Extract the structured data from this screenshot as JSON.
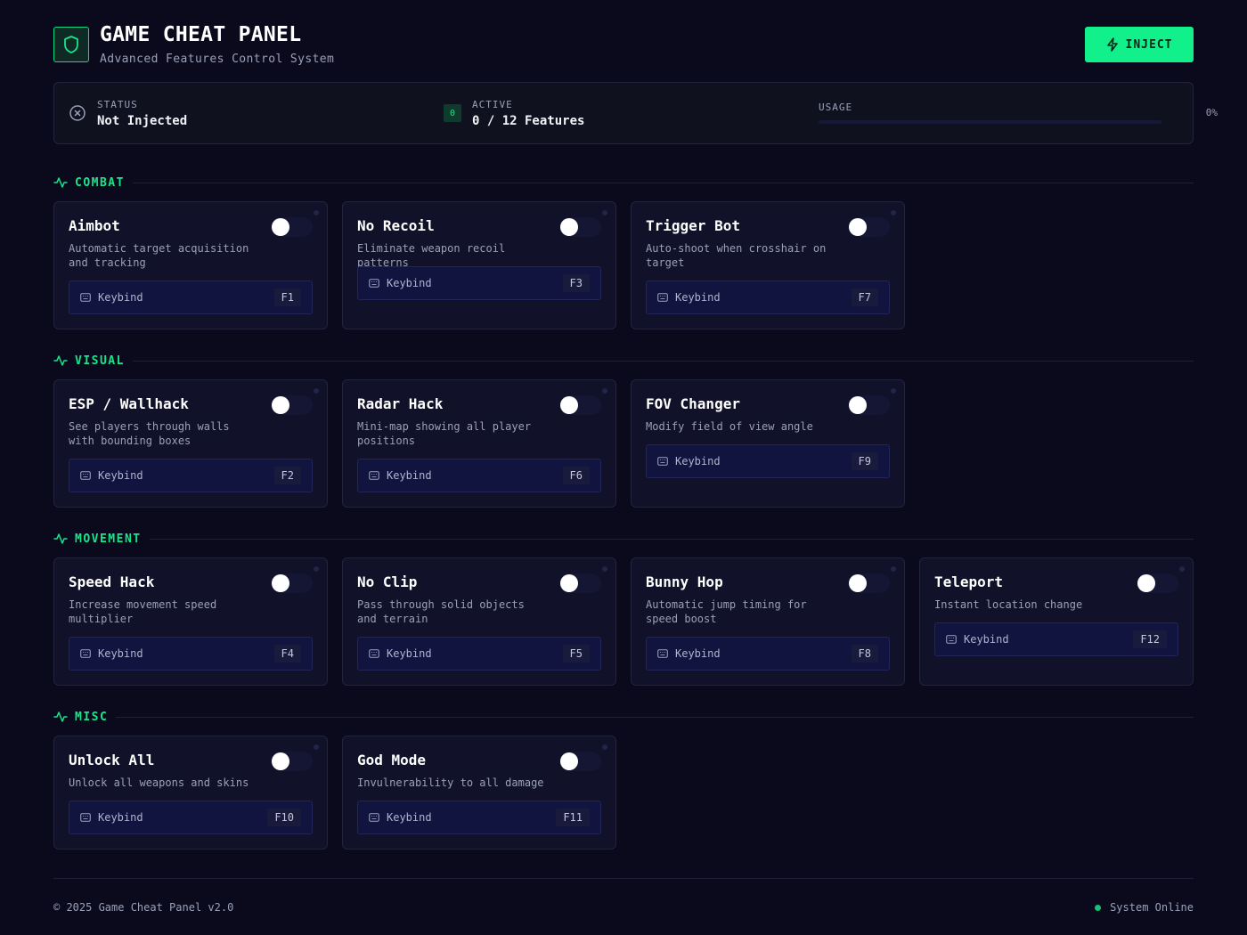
{
  "header": {
    "title": "GAME CHEAT PANEL",
    "subtitle": "Advanced Features Control System",
    "inject_label": "INJECT"
  },
  "status": {
    "status_label": "STATUS",
    "status_value": "Not Injected",
    "active_label": "ACTIVE",
    "active_badge": "0",
    "active_value": "0 / 12 Features",
    "usage_label": "USAGE",
    "usage_percent": "0%",
    "usage_fraction": 0
  },
  "sections": [
    {
      "title": "COMBAT",
      "features": [
        {
          "name": "Aimbot",
          "description": "Automatic target acquisition and tracking",
          "keybind_label": "Keybind",
          "key": "F1",
          "enabled": false
        },
        {
          "name": "No Recoil",
          "description": "Eliminate weapon recoil patterns",
          "keybind_label": "Keybind",
          "key": "F3",
          "enabled": false
        },
        {
          "name": "Trigger Bot",
          "description": "Auto-shoot when crosshair on target",
          "keybind_label": "Keybind",
          "key": "F7",
          "enabled": false
        }
      ]
    },
    {
      "title": "VISUAL",
      "features": [
        {
          "name": "ESP / Wallhack",
          "description": "See players through walls with bounding boxes",
          "keybind_label": "Keybind",
          "key": "F2",
          "enabled": false
        },
        {
          "name": "Radar Hack",
          "description": "Mini-map showing all player positions",
          "keybind_label": "Keybind",
          "key": "F6",
          "enabled": false
        },
        {
          "name": "FOV Changer",
          "description": "Modify field of view angle",
          "keybind_label": "Keybind",
          "key": "F9",
          "enabled": false
        }
      ]
    },
    {
      "title": "MOVEMENT",
      "features": [
        {
          "name": "Speed Hack",
          "description": "Increase movement speed multiplier",
          "keybind_label": "Keybind",
          "key": "F4",
          "enabled": false
        },
        {
          "name": "No Clip",
          "description": "Pass through solid objects and terrain",
          "keybind_label": "Keybind",
          "key": "F5",
          "enabled": false
        },
        {
          "name": "Bunny Hop",
          "description": "Automatic jump timing for speed boost",
          "keybind_label": "Keybind",
          "key": "F8",
          "enabled": false
        },
        {
          "name": "Teleport",
          "description": "Instant location change",
          "keybind_label": "Keybind",
          "key": "F12",
          "enabled": false
        }
      ]
    },
    {
      "title": "MISC",
      "features": [
        {
          "name": "Unlock All",
          "description": "Unlock all weapons and skins",
          "keybind_label": "Keybind",
          "key": "F10",
          "enabled": false
        },
        {
          "name": "God Mode",
          "description": "Invulnerability to all damage",
          "keybind_label": "Keybind",
          "key": "F11",
          "enabled": false
        }
      ]
    }
  ],
  "footer": {
    "copyright": "© 2025 Game Cheat Panel v2.0",
    "system_status": "System Online"
  },
  "colors": {
    "accent": "#11f08a",
    "background": "#0a0a1c",
    "card": "#11112a"
  }
}
